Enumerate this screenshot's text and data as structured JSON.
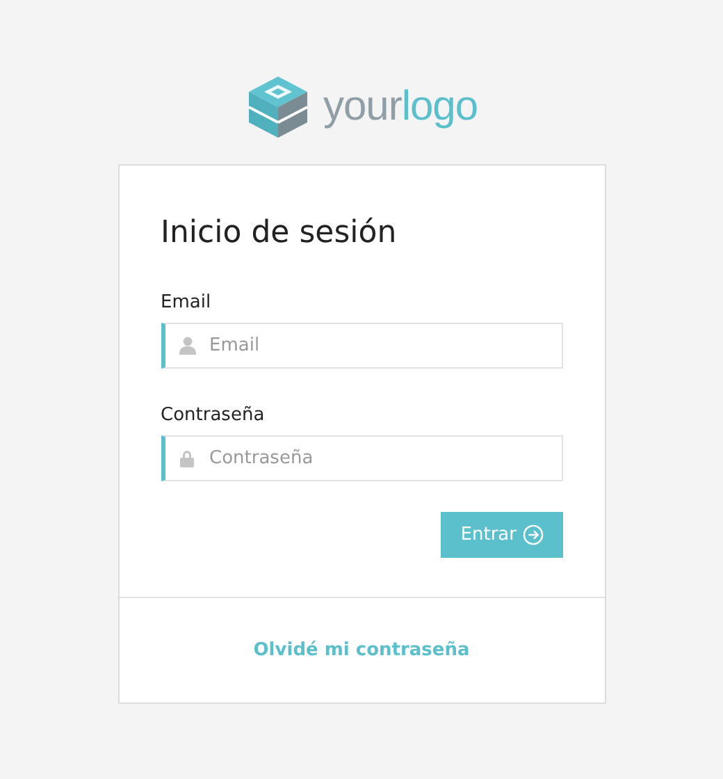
{
  "logo": {
    "word_1": "your",
    "word_2": "logo"
  },
  "title": "Inicio de sesión",
  "fields": [
    {
      "kind": "user",
      "label": "Email",
      "placeholder": "Email"
    },
    {
      "kind": "lock",
      "label": "Contraseña",
      "placeholder": "Contraseña"
    }
  ],
  "submit": "Entrar",
  "forgot_link": "Olvidé mi contraseña"
}
